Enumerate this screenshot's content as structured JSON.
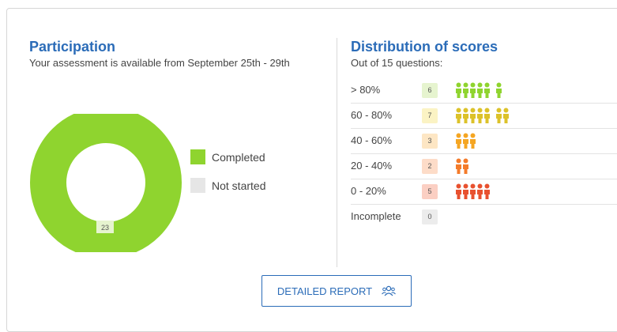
{
  "participation": {
    "title": "Participation",
    "subtitle": "Your assessment is available from September 25th - 29th",
    "completed_count": "23",
    "legend": [
      {
        "label": "Completed",
        "color": "#8fd42f"
      },
      {
        "label": "Not started",
        "color": "#e6e6e6"
      }
    ],
    "completed_fraction": 1.0
  },
  "distribution": {
    "title": "Distribution of scores",
    "subtitle": "Out of 15 questions:",
    "rows": [
      {
        "label": "> 80%",
        "count": "6",
        "people": 6,
        "badge_bg": "#e6f4cf",
        "person_color": "#8fd42f"
      },
      {
        "label": "60 - 80%",
        "count": "7",
        "people": 7,
        "badge_bg": "#fbf3c4",
        "person_color": "#dcc22a"
      },
      {
        "label": "40 - 60%",
        "count": "3",
        "people": 3,
        "badge_bg": "#fde6c4",
        "person_color": "#f5a623"
      },
      {
        "label": "20 - 40%",
        "count": "2",
        "people": 2,
        "badge_bg": "#fddcc8",
        "person_color": "#f47b2a"
      },
      {
        "label": "0 - 20%",
        "count": "5",
        "people": 5,
        "badge_bg": "#fbcfc3",
        "person_color": "#e8512f"
      },
      {
        "label": "Incomplete",
        "count": "0",
        "people": 0,
        "badge_bg": "#ececec",
        "person_color": "#bbbbbb"
      }
    ]
  },
  "actions": {
    "report_label": "DETAILED REPORT",
    "report_icon": "people-group-icon"
  },
  "colors": {
    "accent": "#2b6cb8"
  }
}
